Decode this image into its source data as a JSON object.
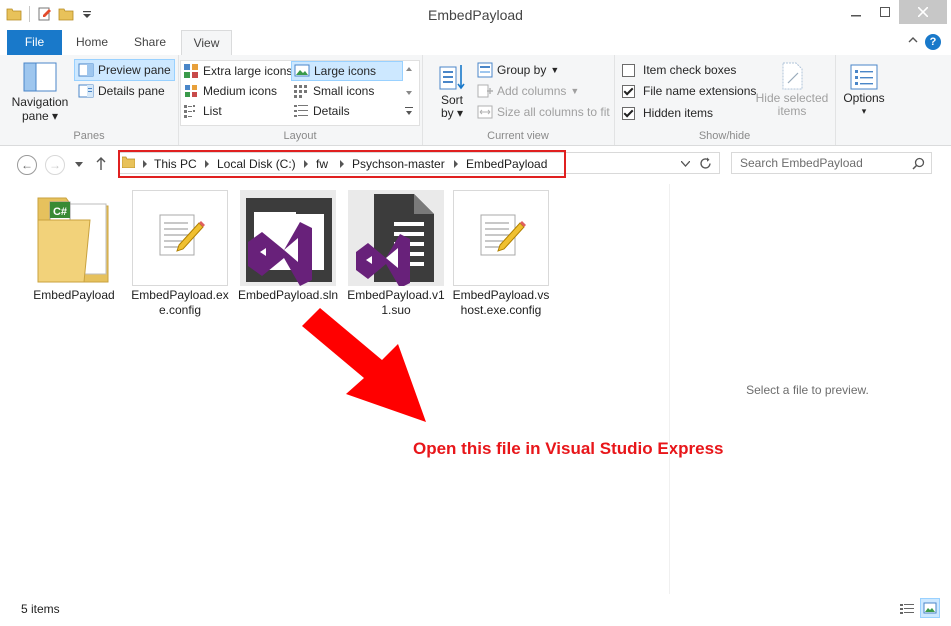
{
  "window": {
    "title": "EmbedPayload"
  },
  "ribbon_tabs": [
    {
      "label": "File"
    },
    {
      "label": "Home"
    },
    {
      "label": "Share"
    },
    {
      "label": "View"
    }
  ],
  "ribbon": {
    "panes": {
      "group_label": "Panes",
      "navigation_pane_line1": "Navigation",
      "navigation_pane_line2": "pane",
      "preview_pane": "Preview pane",
      "details_pane": "Details pane"
    },
    "layout": {
      "group_label": "Layout",
      "options": [
        "Extra large icons",
        "Large icons",
        "Medium icons",
        "Small icons",
        "List",
        "Details"
      ],
      "selected": "Large icons"
    },
    "current_view": {
      "group_label": "Current view",
      "sort_line1": "Sort",
      "sort_line2": "by",
      "group_by": "Group by",
      "add_columns": "Add columns",
      "size_columns": "Size all columns to fit"
    },
    "show_hide": {
      "group_label": "Show/hide",
      "item_check_boxes": "Item check boxes",
      "item_check_boxes_checked": false,
      "file_name_extensions": "File name extensions",
      "file_name_extensions_checked": true,
      "hidden_items": "Hidden items",
      "hidden_items_checked": true,
      "hide_selected_line1": "Hide selected",
      "hide_selected_line2": "items"
    },
    "options_label": "Options"
  },
  "address": {
    "breadcrumbs": [
      "This PC",
      "Local Disk (C:)",
      "fw",
      "Psychson-master",
      "EmbedPayload"
    ]
  },
  "search": {
    "placeholder": "Search EmbedPayload"
  },
  "files": [
    {
      "name": "EmbedPayload",
      "icon": "csharp-folder-icon"
    },
    {
      "name": "EmbedPayload.exe.config",
      "icon": "config-file-icon"
    },
    {
      "name": "EmbedPayload.sln",
      "icon": "visual-studio-solution-icon"
    },
    {
      "name": "EmbedPayload.v11.suo",
      "icon": "visual-studio-suo-icon"
    },
    {
      "name": "EmbedPayload.vshost.exe.config",
      "icon": "config-file-icon"
    }
  ],
  "preview": {
    "message": "Select a file to preview."
  },
  "annotation": {
    "text": "Open this file in Visual Studio Express"
  },
  "status": {
    "item_count": "5 items"
  },
  "colors": {
    "accent": "#1979ca",
    "annotation_red": "#e8161a",
    "vs_purple": "#68217a"
  }
}
